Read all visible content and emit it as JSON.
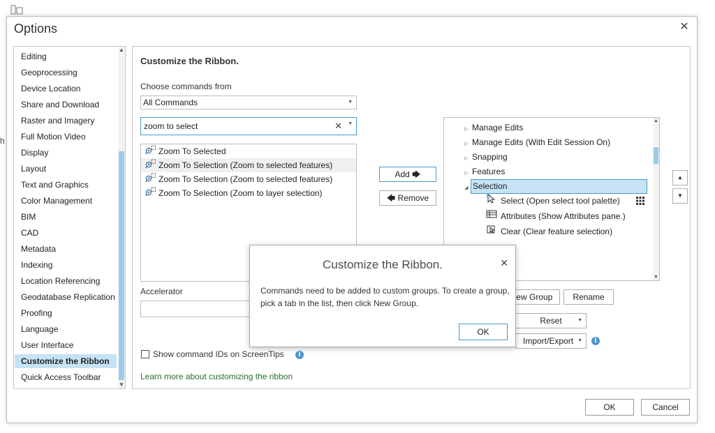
{
  "window": {
    "title": "Options",
    "close_icon": "close-icon"
  },
  "sidebar": {
    "items": [
      {
        "label": "Editing"
      },
      {
        "label": "Geoprocessing"
      },
      {
        "label": "Device Location"
      },
      {
        "label": "Share and Download"
      },
      {
        "label": "Raster and Imagery"
      },
      {
        "label": "Full Motion Video"
      },
      {
        "label": "Display"
      },
      {
        "label": "Layout"
      },
      {
        "label": "Text and Graphics"
      },
      {
        "label": "Color Management"
      },
      {
        "label": "BIM"
      },
      {
        "label": "CAD"
      },
      {
        "label": "Metadata"
      },
      {
        "label": "Indexing"
      },
      {
        "label": "Location Referencing"
      },
      {
        "label": "Geodatabase Replication"
      },
      {
        "label": "Proofing"
      },
      {
        "label": "Language"
      },
      {
        "label": "User Interface"
      },
      {
        "label": "Customize the Ribbon"
      },
      {
        "label": "Quick Access Toolbar"
      }
    ],
    "selected": "Customize the Ribbon"
  },
  "main": {
    "heading": "Customize the Ribbon.",
    "choose_label": "Choose commands from",
    "choose_value": "All Commands",
    "search_value": "zoom to select",
    "commands": [
      {
        "label": "Zoom To Selected"
      },
      {
        "label": "Zoom To Selection (Zoom to selected features)"
      },
      {
        "label": "Zoom To Selection (Zoom to selected features)"
      },
      {
        "label": "Zoom To Selection (Zoom to layer selection)"
      }
    ],
    "add_label": "Add",
    "remove_label": "Remove",
    "accelerator_label": "Accelerator",
    "show_ids_label": "Show command IDs on ScreenTips",
    "learn_link": "Learn more about customizing the ribbon",
    "tree": [
      {
        "label": "Manage Edits",
        "type": "group"
      },
      {
        "label": "Manage Edits (With Edit Session On)",
        "type": "group"
      },
      {
        "label": "Snapping",
        "type": "group"
      },
      {
        "label": "Features",
        "type": "group"
      },
      {
        "label": "Selection",
        "type": "group-expanded"
      },
      {
        "label": "Select (Open select tool palette)",
        "type": "command"
      },
      {
        "label": "Attributes (Show Attributes pane.)",
        "type": "command"
      },
      {
        "label": "Clear (Clear feature selection)",
        "type": "command"
      }
    ],
    "new_group_label": "New Group",
    "rename_label": "Rename",
    "reset_label": "Reset",
    "import_export_label": "Import/Export"
  },
  "modal": {
    "title": "Customize the Ribbon.",
    "message": "Commands need to be added to custom groups. To create a group, pick a tab in the list, then click New Group.",
    "ok_label": "OK"
  },
  "footer": {
    "ok_label": "OK",
    "cancel_label": "Cancel"
  },
  "colors": {
    "accent": "#4a98c9",
    "selected_bg": "#c5e3f5",
    "link": "#2d6d2d"
  }
}
